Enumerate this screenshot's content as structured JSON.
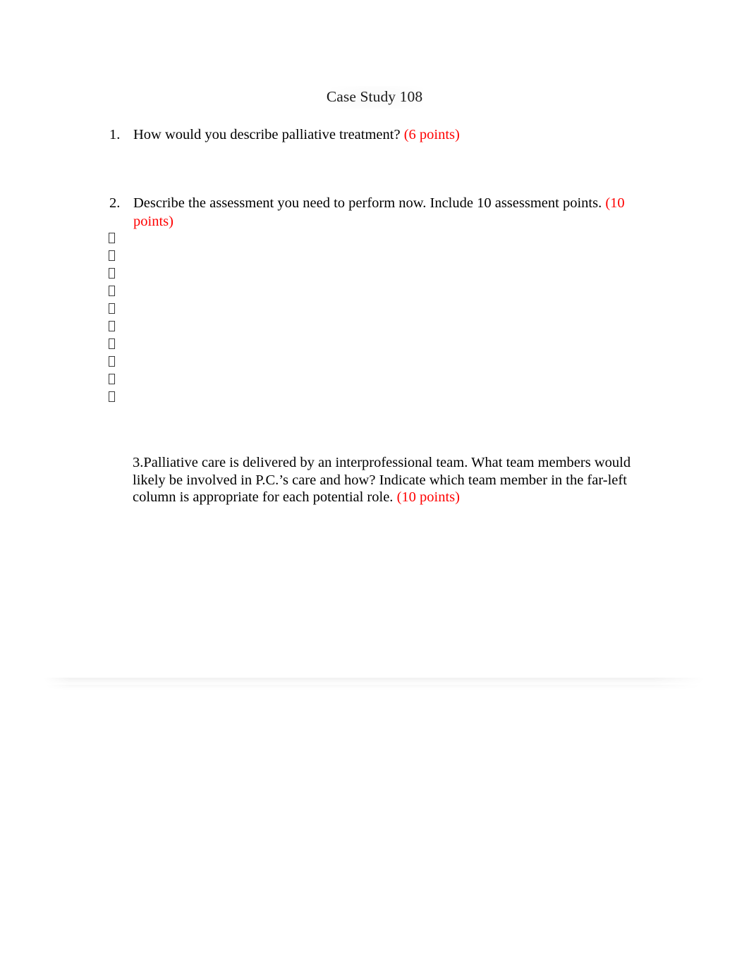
{
  "document": {
    "title": "Case Study 108",
    "accent_red": "#ff0000",
    "text_color": "#000000",
    "page_background": "#ffffff"
  },
  "questions": [
    {
      "number": "1.",
      "prompt": "How would you describe palliative treatment? ",
      "points": "(6 points)"
    },
    {
      "number": "2.",
      "prompt": "Describe the assessment you need to perform now. Include 10 assessment points. ",
      "points": "(10 points)"
    }
  ],
  "assessment_points": {
    "count": 10,
    "bullet_glyph": "missing-glyph-box",
    "items": [
      "",
      "",
      "",
      "",
      "",
      "",
      "",
      "",
      "",
      ""
    ]
  },
  "question_3": {
    "prompt": "3.Palliative care is delivered by an interprofessional team. What team members would likely be involved in P.C.’s care and how? Indicate which team member in the far-left column is appropriate for each potential role.  ",
    "points": "(10 points)"
  }
}
